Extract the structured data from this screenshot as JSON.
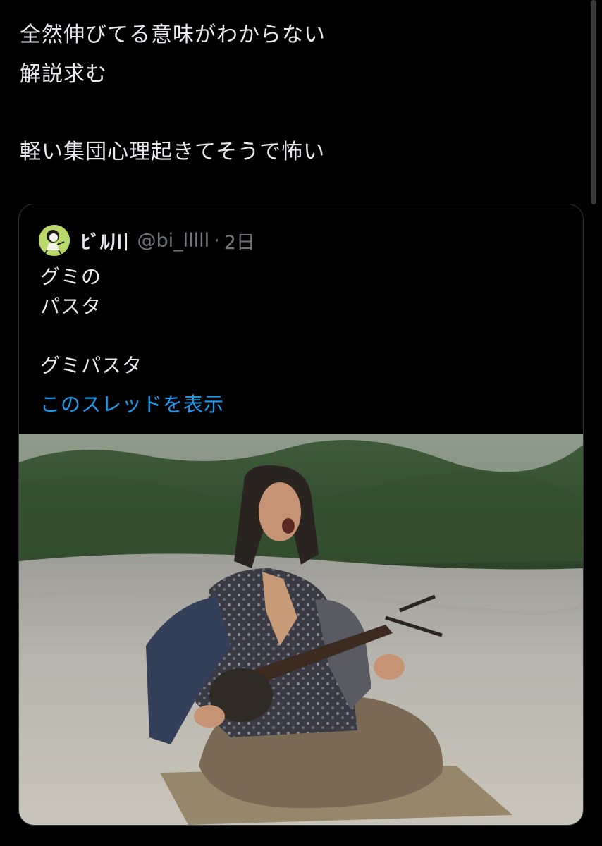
{
  "tweet": {
    "lines": [
      "全然伸びてる意味がわからない",
      "解説求む",
      "",
      "軽い集団心理起きてそうで怖い"
    ]
  },
  "quote": {
    "display_name": "ﾋﾞﾙ川",
    "handle": "@bi_lllll",
    "separator": "·",
    "age": "2日",
    "avatar_icon": "cartoon-character-avatar",
    "lines": [
      "グミの",
      "パスタ",
      "",
      "グミパスタ"
    ],
    "show_thread": "このスレッドを表示"
  },
  "colors": {
    "background": "#000000",
    "text": "#e7e9ea",
    "muted": "#71767b",
    "link": "#1d9bf0",
    "border": "#2f3336"
  }
}
